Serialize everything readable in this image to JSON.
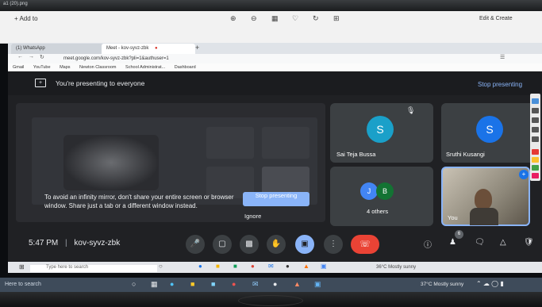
{
  "photos_title": "a1 (20).png",
  "photos_toolbar": {
    "add_to": "+ Add to",
    "edit_create": "Edit & Create"
  },
  "browser": {
    "tabs": [
      {
        "label": "(1) WhatsApp"
      },
      {
        "label": "Meet - kov-syvz-zbk"
      }
    ],
    "url": "meet.google.com/kov-syvz-zbk?pli=1&authuser=1",
    "bookmarks": [
      "Gmail",
      "YouTube",
      "Maps",
      "Newton Classroom",
      "School Administrat...",
      "Dashboard"
    ]
  },
  "meet": {
    "presenting_banner": "You're presenting to everyone",
    "stop_presenting_link": "Stop presenting",
    "mirror_message": "To avoid an infinity mirror, don't share your entire screen or browser window. Share just a tab or a different window instead.",
    "stop_presenting_button": "Stop presenting",
    "ignore_button": "Ignore",
    "participants": [
      {
        "name": "Sai Teja Bussa",
        "initial": "S",
        "color": "#1aa0c9"
      },
      {
        "name": "Sruthi Kusangi",
        "initial": "S",
        "color": "#1a73e8"
      }
    ],
    "others": {
      "label": "4 others",
      "initials": [
        "J",
        "B"
      ],
      "colors": [
        "#4285f4",
        "#137333"
      ]
    },
    "self_label": "You",
    "badge_count": "6",
    "clock": "5:47 PM",
    "separator": "|",
    "meeting_code": "kov-syvz-zbk"
  },
  "taskbar": {
    "search_placeholder": "Type here to search",
    "weather": "36°C  Mostly sunny",
    "weather2": "37°C  Mostly sunny",
    "search_placeholder2": "Here to search"
  }
}
